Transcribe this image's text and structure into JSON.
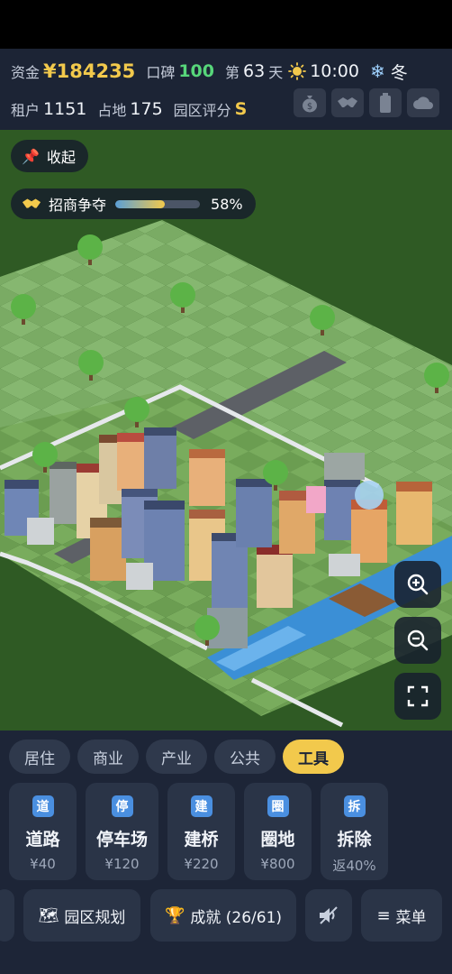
{
  "status": {
    "funds_label": "资金",
    "funds_value": "¥184235",
    "reputation_label": "口碑",
    "reputation_value": "100",
    "day_prefix": "第",
    "day_value": "63",
    "day_suffix": "天",
    "time": "10:00",
    "season": "冬",
    "tenants_label": "租户",
    "tenants_value": "1151",
    "land_label": "占地",
    "land_value": "175",
    "rating_label": "园区评分",
    "rating_value": "S"
  },
  "overlay": {
    "collapse_label": "收起",
    "bidding_label": "招商争夺",
    "bidding_progress": 0.58,
    "bidding_percent": "58%"
  },
  "categories": [
    {
      "label": "居住",
      "active": false
    },
    {
      "label": "商业",
      "active": false
    },
    {
      "label": "产业",
      "active": false
    },
    {
      "label": "公共",
      "active": false
    },
    {
      "label": "工具",
      "active": true
    }
  ],
  "tools": [
    {
      "badge": "道",
      "name": "道路",
      "cost": "¥40"
    },
    {
      "badge": "停",
      "name": "停车场",
      "cost": "¥120"
    },
    {
      "badge": "建",
      "name": "建桥",
      "cost": "¥220"
    },
    {
      "badge": "圈",
      "name": "圈地",
      "cost": "¥800"
    },
    {
      "badge": "拆",
      "name": "拆除",
      "cost": "返40%"
    }
  ],
  "bottom": {
    "plan_label": "园区规划",
    "achievements_label": "成就 (26/61)",
    "menu_label": "菜单"
  },
  "icons": {
    "money_bag": "money-bag-icon",
    "handshake": "handshake-icon",
    "battery": "battery-icon",
    "cloud": "cloud-icon",
    "pin": "pin-icon",
    "trophy": "trophy-icon",
    "speaker": "speaker-icon",
    "map": "map-icon"
  },
  "colors": {
    "accent": "#f2c94c",
    "green": "#57d67a",
    "panel": "#1d2537"
  }
}
